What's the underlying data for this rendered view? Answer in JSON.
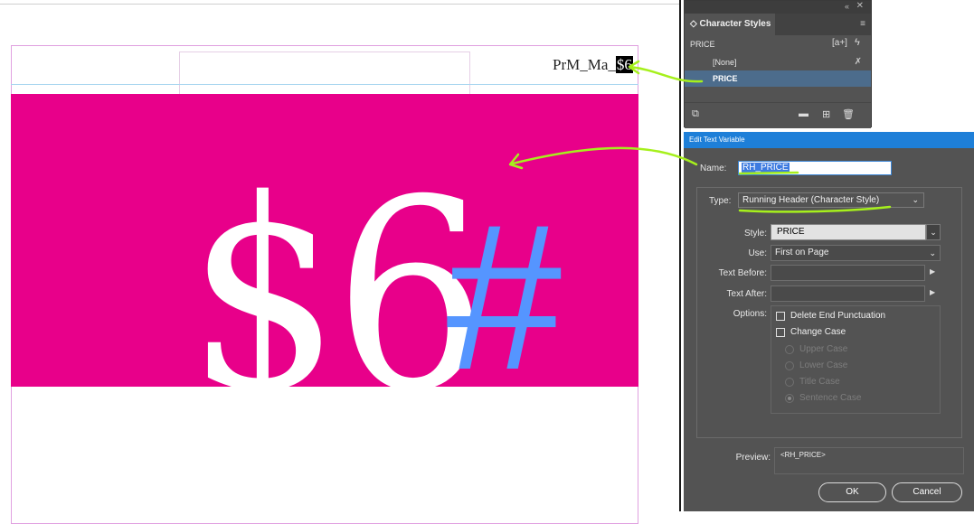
{
  "document": {
    "header_prefix": "PrM_Ma_",
    "header_price": "$6",
    "big_price": "$6",
    "big_hash": "#",
    "colors": {
      "banner": "#e8008a",
      "hash": "#5595ff",
      "arrow": "#a6f01c"
    }
  },
  "char_styles_panel": {
    "title": "Character Styles",
    "current_style": "PRICE",
    "collapse_icon": "«",
    "close_icon": "✕",
    "menu_icon": "≡",
    "new_icon": "[a+]",
    "items": [
      {
        "label": "[None]"
      },
      {
        "label": "PRICE",
        "selected": true
      }
    ]
  },
  "dialog": {
    "title": "Edit Text Variable",
    "name_label": "Name:",
    "name_value": "RH_PRICE",
    "type_label": "Type:",
    "type_value": "Running Header (Character Style)",
    "style_label": "Style:",
    "style_value": "PRICE",
    "use_label": "Use:",
    "use_value": "First on Page",
    "text_before_label": "Text Before:",
    "text_before_value": "",
    "text_after_label": "Text After:",
    "text_after_value": "",
    "options_label": "Options:",
    "options": {
      "delete_end_punctuation": "Delete End Punctuation",
      "change_case": "Change Case",
      "upper_case": "Upper Case",
      "lower_case": "Lower Case",
      "title_case": "Title Case",
      "sentence_case": "Sentence Case"
    },
    "preview_label": "Preview:",
    "preview_value": "<RH_PRICE>",
    "ok_label": "OK",
    "cancel_label": "Cancel"
  }
}
